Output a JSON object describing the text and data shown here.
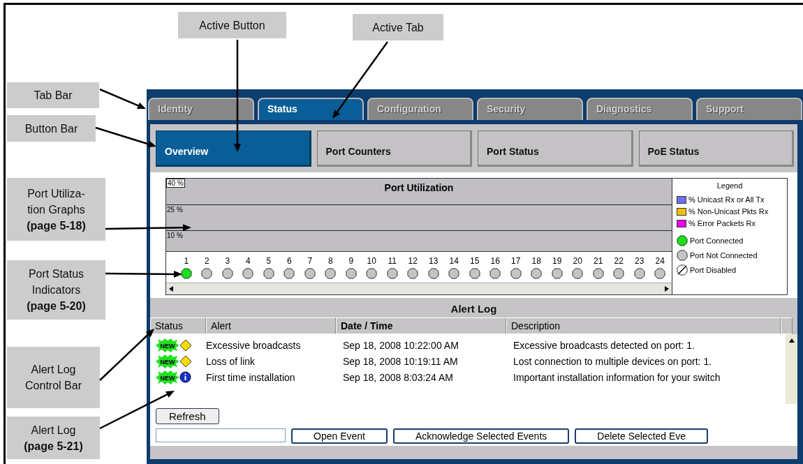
{
  "callouts": [
    {
      "text": "Active Button"
    },
    {
      "text": "Active Tab"
    },
    {
      "text": "Tab Bar"
    },
    {
      "text": "Button Bar"
    },
    {
      "text": "Port Utiliza-\ntion Graphs\n**(page 5-18)**"
    },
    {
      "text": "Port Status\nIndicators\n**(page 5-20)**"
    },
    {
      "text": "Alert Log\nControl Bar"
    },
    {
      "text": "Alert Log\n**(page 5-21)**"
    }
  ],
  "tabs": [
    {
      "label": "Identity",
      "selected": false
    },
    {
      "label": "Status",
      "selected": true
    },
    {
      "label": "Configuration",
      "selected": false
    },
    {
      "label": "Security",
      "selected": false
    },
    {
      "label": "Diagnostics",
      "selected": false
    },
    {
      "label": "Support",
      "selected": false
    }
  ],
  "buttons": [
    {
      "label": "Overview",
      "selected": true
    },
    {
      "label": "Port Counters",
      "selected": false
    },
    {
      "label": "Port Status",
      "selected": false
    },
    {
      "label": "PoE Status",
      "selected": false
    }
  ],
  "graph": {
    "title": "Port Utilization",
    "gridlines": [
      "40 %",
      "25 %",
      "10 %"
    ],
    "ports": [
      {
        "label": "1",
        "connected": true
      },
      {
        "label": "2",
        "connected": false
      },
      {
        "label": "3",
        "connected": false
      },
      {
        "label": "4",
        "connected": false
      },
      {
        "label": "5",
        "connected": false
      },
      {
        "label": "6",
        "connected": false
      },
      {
        "label": "7",
        "connected": false
      },
      {
        "label": "8",
        "connected": false
      },
      {
        "label": "9",
        "connected": false
      },
      {
        "label": "10",
        "connected": false
      },
      {
        "label": "11",
        "connected": false
      },
      {
        "label": "12",
        "connected": false
      },
      {
        "label": "13",
        "connected": false
      },
      {
        "label": "14",
        "connected": false
      },
      {
        "label": "15",
        "connected": false
      },
      {
        "label": "16",
        "connected": false
      },
      {
        "label": "17",
        "connected": false
      },
      {
        "label": "18",
        "connected": false
      },
      {
        "label": "19",
        "connected": false
      },
      {
        "label": "20",
        "connected": false
      },
      {
        "label": "21",
        "connected": false
      },
      {
        "label": "22",
        "connected": false
      },
      {
        "label": "23",
        "connected": false
      },
      {
        "label": "24",
        "connected": false
      }
    ]
  },
  "legend": {
    "title": "Legend",
    "items": [
      {
        "kind": "swatch",
        "label": "% Unicast Rx or All Tx",
        "color": "#6f6ff0"
      },
      {
        "kind": "swatch",
        "label": "% Non-Unicast Pkts Rx",
        "color": "#f0c000"
      },
      {
        "kind": "swatch",
        "label": "% Error Packets Rx",
        "color": "#f000f0"
      },
      {
        "kind": "connected",
        "label": "Port Connected"
      },
      {
        "kind": "unconnected",
        "label": "Port Not Connected"
      },
      {
        "kind": "disabled",
        "label": "Port Disabled"
      }
    ]
  },
  "alert_log": {
    "title": "Alert Log",
    "columns": [
      {
        "label": "Status",
        "sorted": false
      },
      {
        "label": "Alert",
        "sorted": false
      },
      {
        "label": "Date / Time",
        "sorted": true
      },
      {
        "label": "Description",
        "sorted": false
      }
    ],
    "rows": [
      {
        "badge": "NEW",
        "kind": "warning",
        "alert": "Excessive broadcasts",
        "time": "Sep 18, 2008 10:22:00 AM",
        "description": "Excessive broadcasts detected on port: 1."
      },
      {
        "badge": "NEW",
        "kind": "warning",
        "alert": "Loss of link",
        "time": "Sep 18, 2008 10:19:11 AM",
        "description": "Lost connection to multiple devices on port: 1."
      },
      {
        "badge": "NEW",
        "kind": "info",
        "alert": "First time installation",
        "time": "Sep 18, 2008 8:03:24 AM",
        "description": "Important installation information for your switch"
      }
    ],
    "refresh": "Refresh",
    "actions": [
      "Open Event",
      "Acknowledge Selected Events",
      "Delete Selected Eve"
    ]
  }
}
